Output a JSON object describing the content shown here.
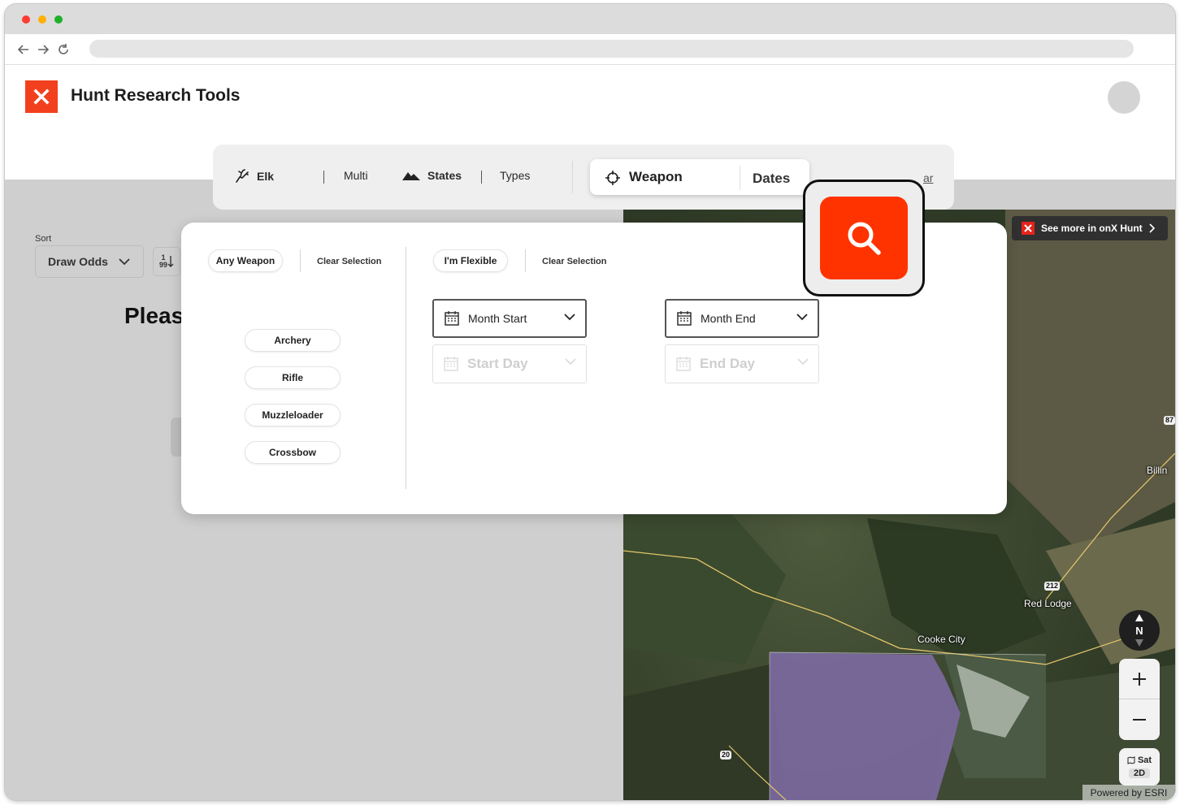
{
  "app": {
    "title": "Hunt Research Tools",
    "brand_color": "#f2401e",
    "accent_color": "#ff3300"
  },
  "searchbar": {
    "species": "Elk",
    "multi": "Multi",
    "states": "States",
    "types": "Types",
    "weapon": "Weapon",
    "dates": "Dates",
    "clear_fragment": "ar"
  },
  "sort": {
    "label": "Sort",
    "value": "Draw Odds",
    "direction_top": "1",
    "direction_bottom": "99"
  },
  "main": {
    "message_fragment": "Pleas"
  },
  "weapon_panel": {
    "any_label": "Any Weapon",
    "clear_label": "Clear Selection",
    "options": [
      "Archery",
      "Rifle",
      "Muzzleloader",
      "Crossbow"
    ]
  },
  "dates_panel": {
    "flexible_label": "I'm Flexible",
    "clear_label": "Clear Selection",
    "month_start": "Month Start",
    "month_end": "Month End",
    "start_day": "Start Day",
    "end_day": "End Day"
  },
  "map": {
    "banner": "See more in onX Hunt",
    "labels": {
      "billings": "Billin",
      "red_lodge": "Red Lodge",
      "cooke_city": "Cooke City"
    },
    "shields": {
      "hwy212": "212",
      "hwy20": "20",
      "hwy87": "87"
    },
    "compass": "N",
    "map_type": "Sat",
    "view_mode": "2D",
    "attribution": "Powered by ESRI"
  }
}
